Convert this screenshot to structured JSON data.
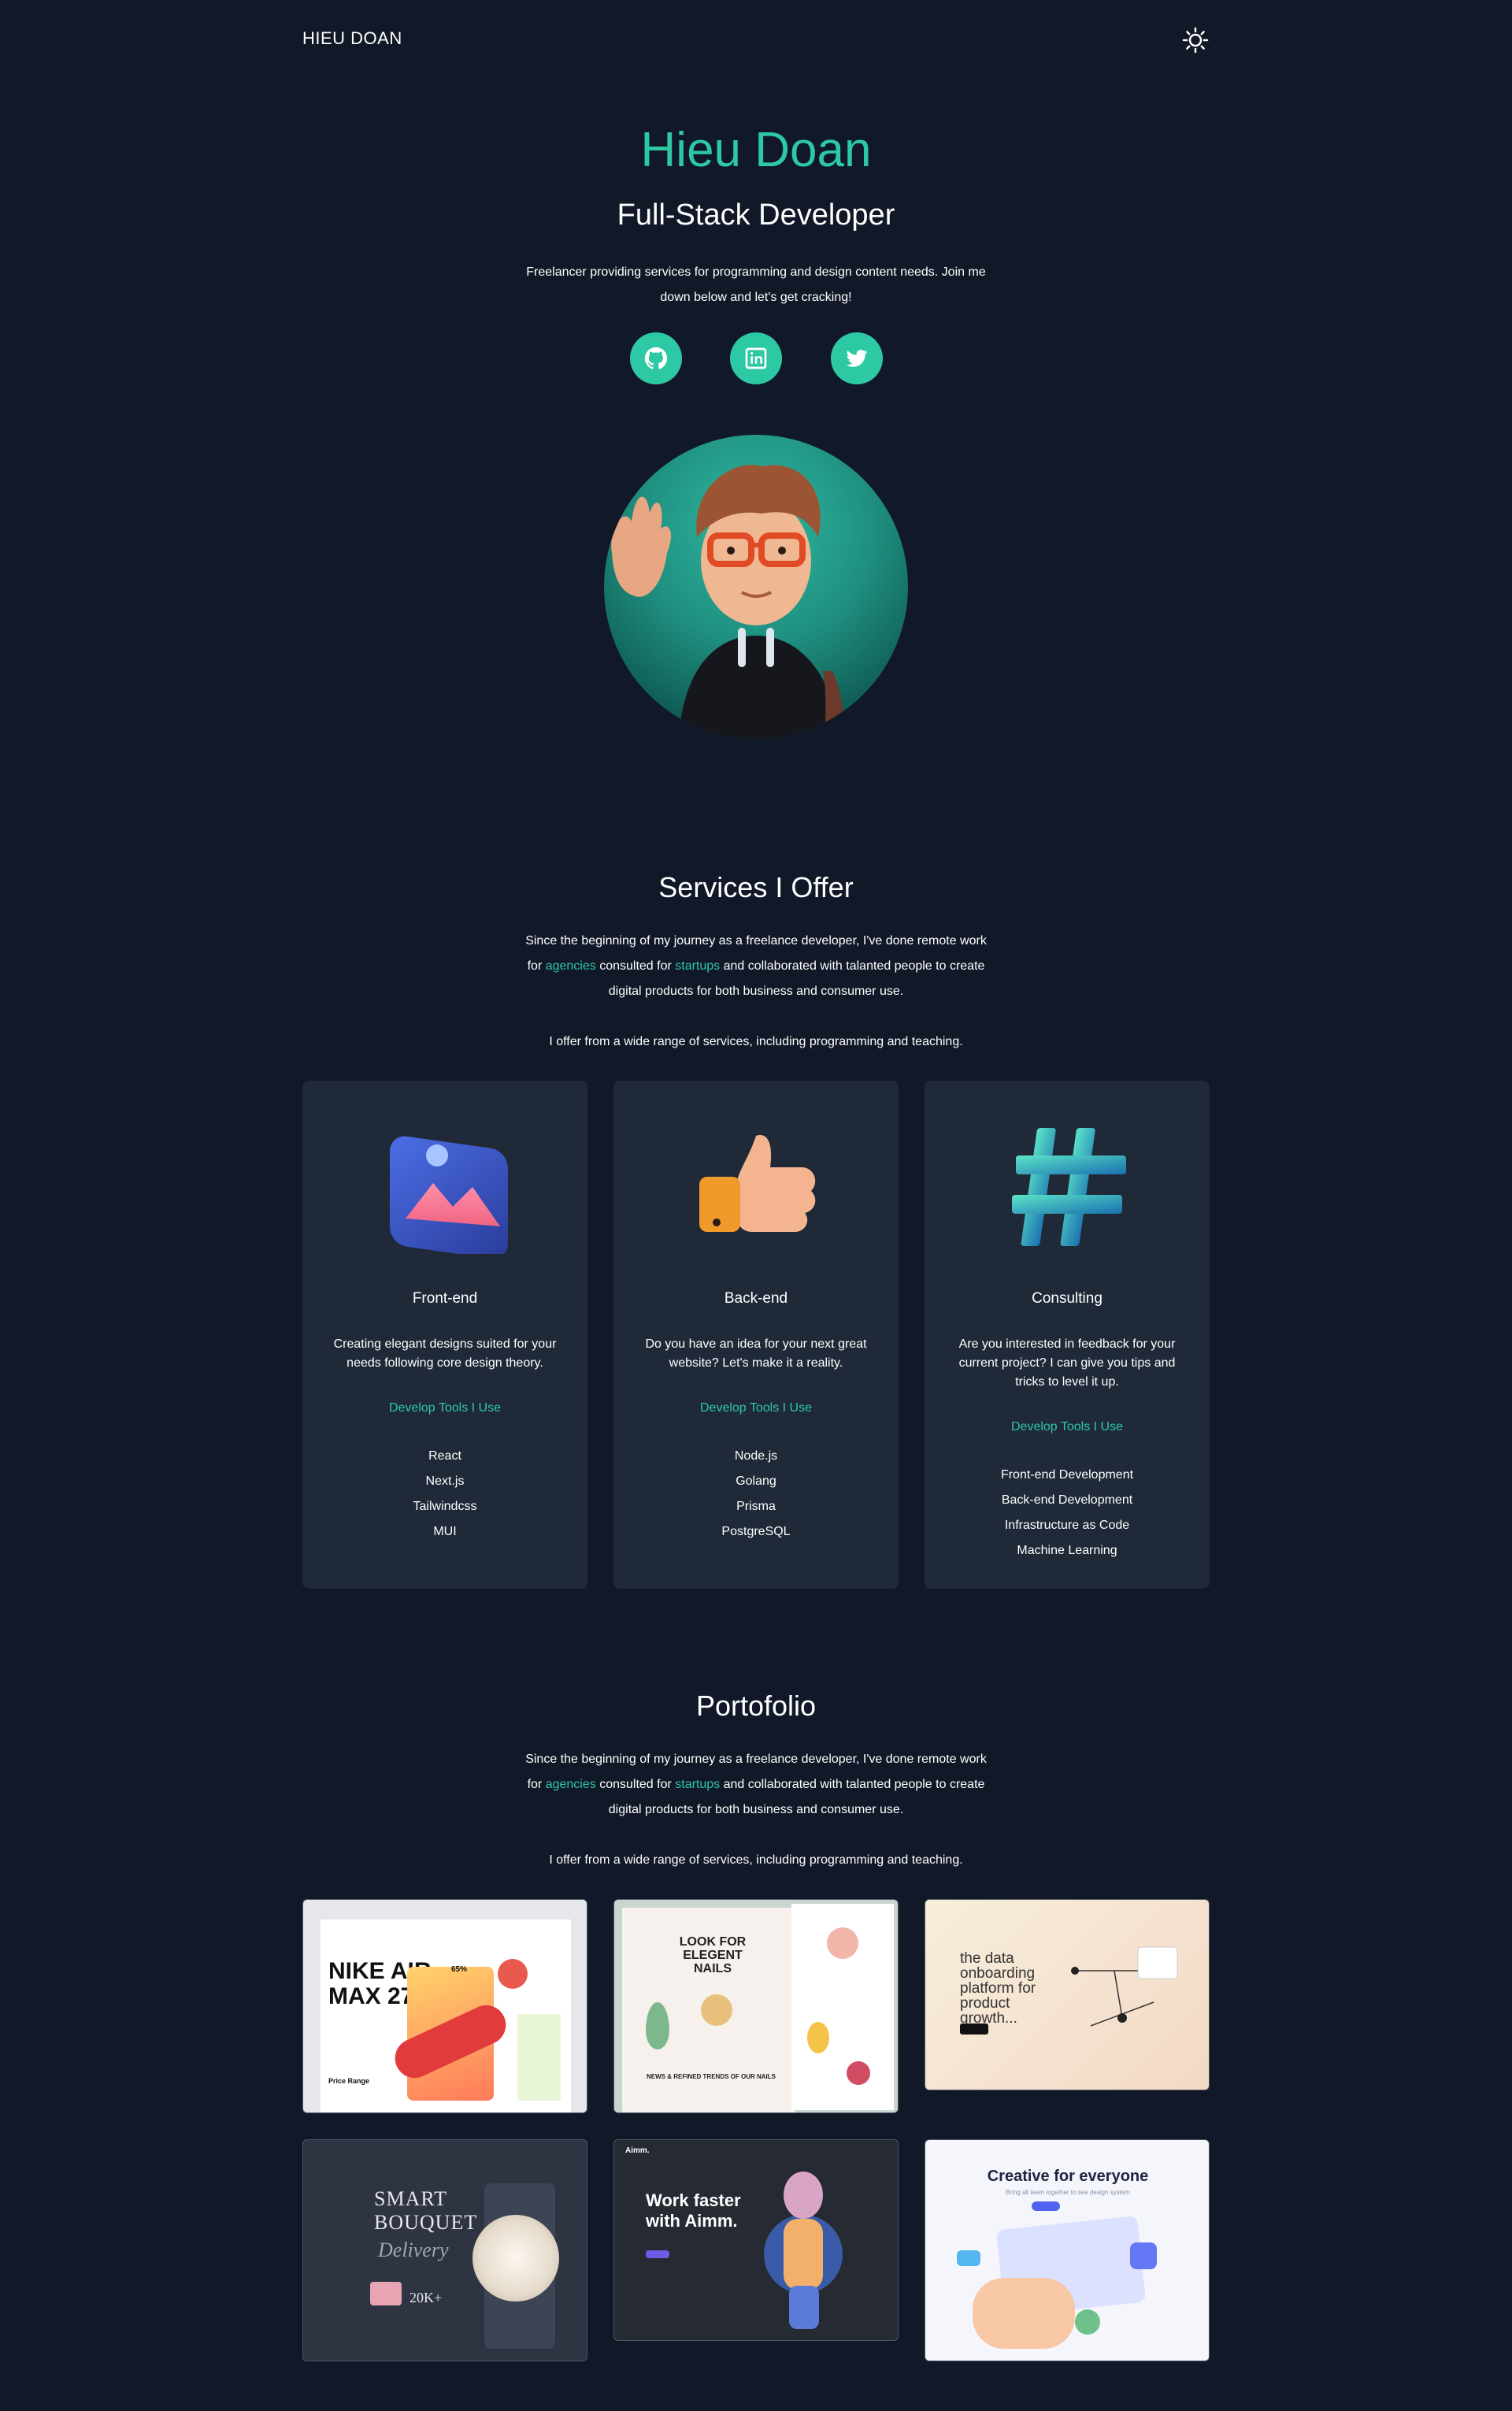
{
  "nav": {
    "brand": "HIEU DOAN",
    "theme_toggle_icon": "sun-icon"
  },
  "hero": {
    "name": "Hieu Doan",
    "role": "Full-Stack Developer",
    "description": "Freelancer providing services for programming and design content needs. Join me down below and let's get cracking!",
    "socials": [
      {
        "icon": "github-icon"
      },
      {
        "icon": "linkedin-icon"
      },
      {
        "icon": "twitter-icon"
      }
    ]
  },
  "services": {
    "title": "Services I Offer",
    "intro_1": "Since the beginning of my journey as a freelance developer, I've done remote work for ",
    "intro_link_1": "agencies",
    "intro_2": " consulted for ",
    "intro_link_2": "startups",
    "intro_3": " and collaborated with talanted people to create digital products for both business and consumer use.",
    "intro_line2": "I offer from a wide range of services, including programming and teaching.",
    "cards": [
      {
        "title": "Front-end",
        "description": "Creating elegant designs suited for your needs following core design theory.",
        "subtitle": "Develop Tools I Use",
        "items": [
          "React",
          "Next.js",
          "Tailwindcss",
          "MUI"
        ]
      },
      {
        "title": "Back-end",
        "description": "Do you have an idea for your next great website? Let's make it a reality.",
        "subtitle": "Develop Tools I Use",
        "items": [
          "Node.js",
          "Golang",
          "Prisma",
          "PostgreSQL"
        ]
      },
      {
        "title": "Consulting",
        "description": "Are you interested in feedback for your current project? I can give you tips and tricks to level it up.",
        "subtitle": "Develop Tools I Use",
        "items": [
          "Front-end Development",
          "Back-end Development",
          "Infrastructure as Code",
          "Machine Learning"
        ]
      }
    ]
  },
  "portfolio": {
    "title": "Portofolio",
    "intro_1": "Since the beginning of my journey as a freelance developer, I've done remote work for ",
    "intro_link_1": "agencies",
    "intro_2": " consulted for ",
    "intro_link_2": "startups",
    "intro_3": " and collaborated with talanted people to create digital products for both business and consumer use.",
    "intro_line2": "I offer from a wide range of services, including programming and teaching.",
    "projects": [
      {
        "headline": "NIKE AIR MAX 270",
        "sub": "Price Range",
        "badge": "65%"
      },
      {
        "headline": "LOOK FOR ELEGENT NAILS",
        "sub": "NEWS & REFINED TRENDS OF OUR NAILS"
      },
      {
        "headline": "the data onboarding platform for product growth...",
        "sub": ""
      },
      {
        "headline": "SMART BOUQUET",
        "sub": "Delivery",
        "badge": "20K+"
      },
      {
        "headline": "Work faster with Aimm.",
        "sub": "Aimm."
      },
      {
        "headline": "Creative for everyone",
        "sub": "Bring all team together to see design system"
      }
    ]
  }
}
